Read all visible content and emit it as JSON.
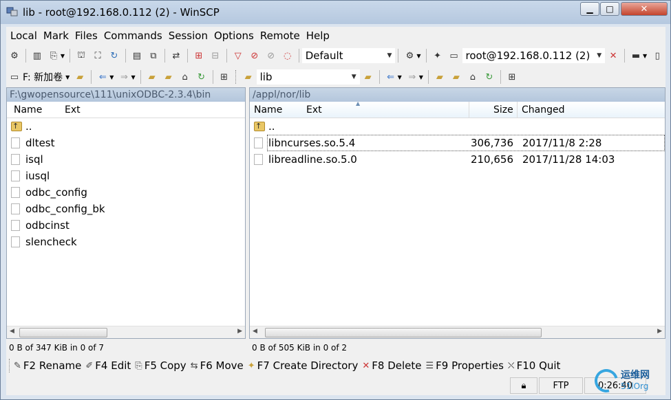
{
  "window": {
    "title": "lib - root@192.168.0.112 (2) - WinSCP"
  },
  "menu": [
    "Local",
    "Mark",
    "Files",
    "Commands",
    "Session",
    "Options",
    "Remote",
    "Help"
  ],
  "toolbar": {
    "transfer_settings": "Default",
    "session": "root@192.168.0.112 (2)"
  },
  "local": {
    "drive": "F: 新加卷",
    "path": "F:\\gwopensource\\111\\unixODBC-2.3.4\\bin",
    "columns": {
      "name": "Name",
      "ext": "Ext"
    },
    "files": [
      "..",
      "dltest",
      "isql",
      "iusql",
      "odbc_config",
      "odbc_config_bk",
      "odbcinst",
      "slencheck"
    ],
    "status": "0 B of 347 KiB in 0 of 7"
  },
  "remote": {
    "dir": "lib",
    "path": "/appl/nor/lib",
    "columns": {
      "name": "Name",
      "ext": "Ext",
      "size": "Size",
      "changed": "Changed"
    },
    "files": [
      {
        "name": "..",
        "size": "",
        "changed": ""
      },
      {
        "name": "libncurses.so.5.4",
        "size": "306,736",
        "changed": "2017/11/8 2:28"
      },
      {
        "name": "libreadline.so.5.0",
        "size": "210,656",
        "changed": "2017/11/28 14:03"
      }
    ],
    "status": "0 B of 505 KiB in 0 of 2"
  },
  "keys": [
    {
      "label": "F2 Rename",
      "icon": "rename-icon"
    },
    {
      "label": "F4 Edit",
      "icon": "edit-icon"
    },
    {
      "label": "F5 Copy",
      "icon": "copy-icon"
    },
    {
      "label": "F6 Move",
      "icon": "move-icon"
    },
    {
      "label": "F7 Create Directory",
      "icon": "new-folder-icon"
    },
    {
      "label": "F8 Delete",
      "icon": "delete-icon"
    },
    {
      "label": "F9 Properties",
      "icon": "properties-icon"
    },
    {
      "label": "F10 Quit",
      "icon": "quit-icon"
    }
  ],
  "statusbar": {
    "protocol": "FTP",
    "elapsed": "0:26:40"
  },
  "watermark": {
    "line1": "运维网",
    "line2": "51lOrg"
  },
  "colors": {
    "accent": "#b5c8df",
    "path_text": "#4b5a6e",
    "close": "#c4442d"
  }
}
